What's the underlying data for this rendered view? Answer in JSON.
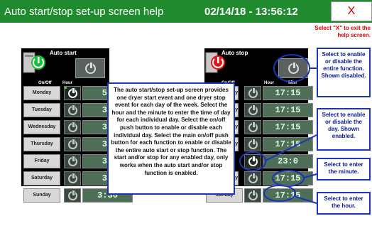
{
  "header": {
    "title": "Auto start/stop set-up screen help",
    "datetime": "02/14/18 - 13:56:12",
    "close_label": "X",
    "close_help": "Select \"X\" to exit the help screen."
  },
  "start_panel": {
    "title": "Auto start",
    "col_onoff": "On/Off",
    "col_hour": "Hour",
    "days": [
      "Monday",
      "Tuesday",
      "Wednesday",
      "Thursday",
      "Friday",
      "Saturday",
      "Sunday"
    ],
    "times_partial": [
      "5",
      "3",
      "3",
      "3",
      "3",
      "3"
    ],
    "sunday_time": "3:30"
  },
  "stop_panel": {
    "title": "Auto stop",
    "col_onoff": "On/Off",
    "col_hour": "Hour",
    "col_min": "Min",
    "days_partial": [
      "y",
      "y",
      "lay",
      "ay",
      "",
      "lay",
      "Sunday"
    ],
    "times": [
      "17:15",
      "17:15",
      "17:15",
      "17:15",
      "23:0",
      "17:15",
      "17:15"
    ]
  },
  "help_text": "The auto start/stop set-up screen provides one dryer start event and one dryer stop event for each day of the week. Select the hour and the minute to enter the time of day for each individual day. Select the on/off push button to enable or disable each individual day. Select the main on/off push button for each function to enable or disable the entire auto start or stop function. The start and/or stop for any enabled day, only works when the auto start and/or stop function is enabled.",
  "callouts": {
    "master": "Select to enable or disable the entire function. Shown disabled.",
    "day": "Select to enable or disable the day. Shown enabled.",
    "minute": "Select to enter the minute.",
    "hour": "Select to enter the hour."
  },
  "colors": {
    "titlebar": "#1f8a2e",
    "callout_border": "#1b34b8",
    "close_text": "#e00000"
  }
}
